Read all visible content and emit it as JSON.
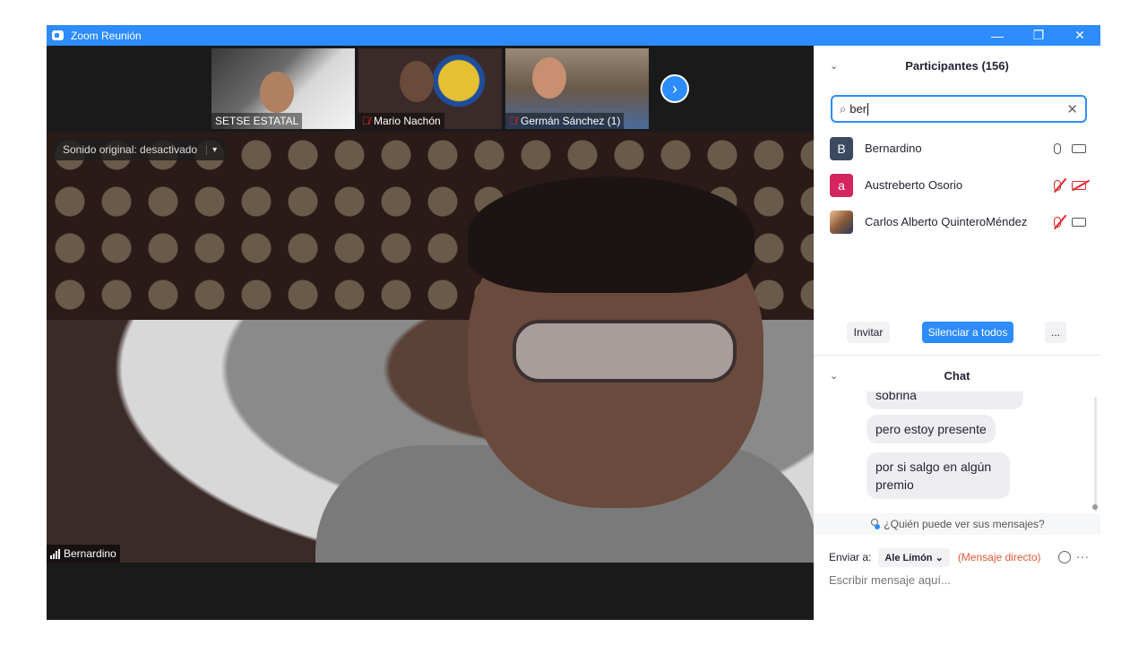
{
  "window": {
    "title": "Zoom Reunión",
    "controls": {
      "minimize": "—",
      "restore": "❐",
      "close": "✕"
    }
  },
  "thumbnails": [
    {
      "name": "SETSE ESTATAL",
      "muted": false
    },
    {
      "name": "Mario Nachón",
      "muted": true
    },
    {
      "name": "Germán Sánchez (1)",
      "muted": true
    }
  ],
  "next_button_icon": "›",
  "main_video": {
    "audio_option": "Sonido original: desactivado",
    "audio_caret": "▾",
    "speaker_name": "Bernardino"
  },
  "participants": {
    "title": "Participantes (156)",
    "collapse_icon": "⌄",
    "search": {
      "value": "ber",
      "search_icon": "⌕",
      "clear_icon": "✕"
    },
    "list": [
      {
        "avatar_letter": "B",
        "name": "Bernardino",
        "mic": "on",
        "video": "on"
      },
      {
        "avatar_letter": "a",
        "name": "Austreberto Osorio",
        "mic": "off",
        "video": "off"
      },
      {
        "avatar_letter": "",
        "name": "Carlos Alberto QuinteroMéndez",
        "mic": "off",
        "video": "on"
      }
    ],
    "buttons": {
      "invite": "Invitar",
      "mute_all": "Silenciar a todos",
      "more": "..."
    }
  },
  "chat": {
    "title": "Chat",
    "collapse_icon": "⌄",
    "messages": [
      "sobrina",
      "pero estoy presente",
      "por si salgo en algún premio"
    ],
    "privacy_text": "¿Quién puede ver sus mensajes?",
    "send_to_label": "Enviar a:",
    "send_to_value": "Ale Limón",
    "send_to_caret": "⌄",
    "direct_message": "(Mensaje directo)",
    "more_icon": "···",
    "input_placeholder": "Escribir mensaje aquí..."
  }
}
